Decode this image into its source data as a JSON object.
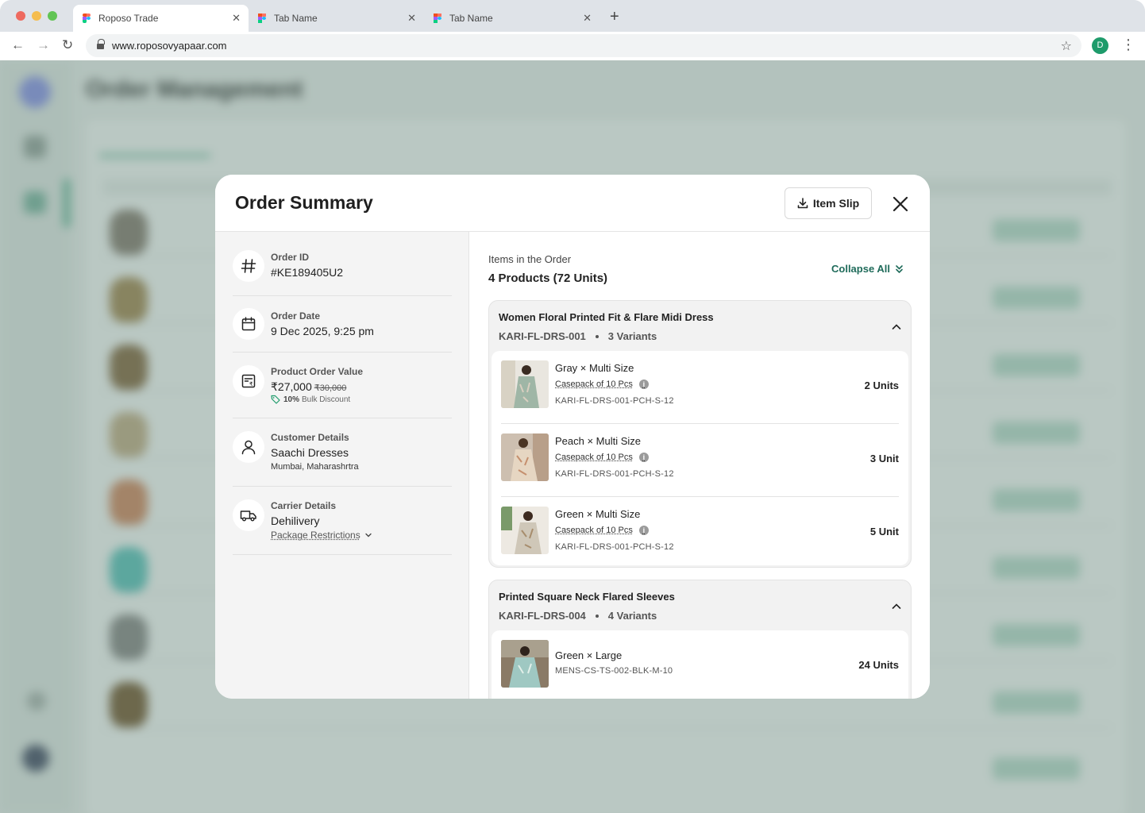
{
  "browser": {
    "tabs": [
      {
        "label": "Roposo Trade",
        "active": true
      },
      {
        "label": "Tab Name",
        "active": false
      },
      {
        "label": "Tab Name",
        "active": false
      }
    ],
    "url": "www.roposovyapaar.com",
    "profile_initial": "D"
  },
  "background": {
    "title": "Order Management"
  },
  "modal": {
    "title": "Order Summary",
    "item_slip_label": "Item Slip",
    "order_id": {
      "label": "Order ID",
      "value": "#KE189405U2"
    },
    "order_date": {
      "label": "Order Date",
      "value": "9 Dec 2025, 9:25 pm"
    },
    "order_value": {
      "label": "Product Order Value",
      "value": "₹27,000",
      "original": "₹30,000",
      "discount_percent": "10%",
      "discount_text": "Bulk Discount"
    },
    "customer": {
      "label": "Customer Details",
      "name": "Saachi Dresses",
      "location": "Mumbai, Maharashrtra"
    },
    "carrier": {
      "label": "Carrier Details",
      "name": "Dehilivery",
      "restrictions_link": "Package Restrictions"
    },
    "items": {
      "label": "Items in the Order",
      "count": "4 Products (72 Units)",
      "collapse_all": "Collapse All",
      "products": [
        {
          "name": "Women Floral Printed Fit & Flare Midi Dress",
          "code": "KARI-FL-DRS-001",
          "variants_count": "3 Variants",
          "variants": [
            {
              "title": "Gray × Multi Size",
              "casepack": "Casepack of 10 Pcs",
              "sku": "KARI-FL-DRS-001-PCH-S-12",
              "units": "2 Units"
            },
            {
              "title": "Peach × Multi Size",
              "casepack": "Casepack of 10 Pcs",
              "sku": "KARI-FL-DRS-001-PCH-S-12",
              "units": "3 Unit"
            },
            {
              "title": "Green × Multi Size",
              "casepack": "Casepack of 10 Pcs",
              "sku": "KARI-FL-DRS-001-PCH-S-12",
              "units": "5 Unit"
            }
          ]
        },
        {
          "name": "Printed Square Neck Flared Sleeves",
          "code": "KARI-FL-DRS-004",
          "variants_count": "4 Variants",
          "variants": [
            {
              "title": "Green × Large",
              "sku": "MENS-CS-TS-002-BLK-M-10",
              "units": "24 Units"
            }
          ]
        }
      ]
    }
  },
  "colors": {
    "accent": "#1f6b5a",
    "overlay": "#5a7d70"
  }
}
